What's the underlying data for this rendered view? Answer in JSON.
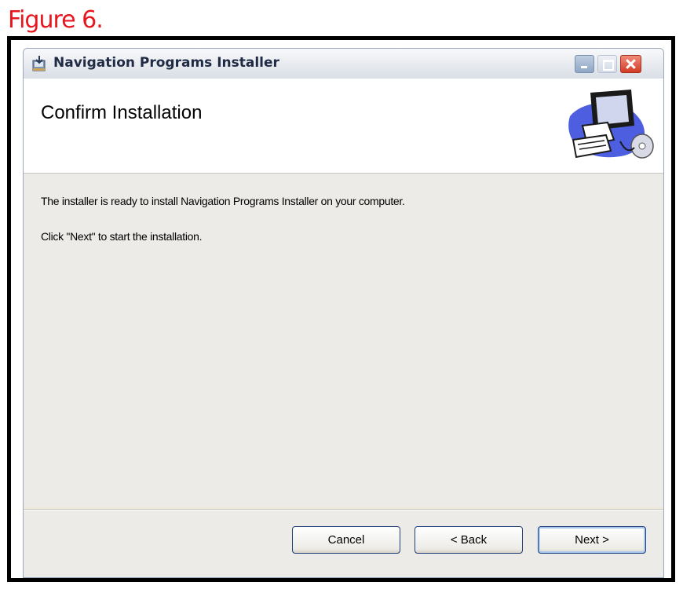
{
  "figure_label": "Figure 6.",
  "window": {
    "title": "Navigation Programs Installer",
    "controls": {
      "minimize": "minimize-icon",
      "maximize": "maximize-icon",
      "close": "close-icon"
    }
  },
  "banner": {
    "heading": "Confirm Installation",
    "art_icon": "computer-cd-icon"
  },
  "body": {
    "line1": "The installer is ready to install Navigation Programs Installer on your computer.",
    "line2": "Click \"Next\" to start the installation."
  },
  "buttons": {
    "cancel": "Cancel",
    "back": "< Back",
    "next": "Next >"
  },
  "colors": {
    "figure_label": "#e8161e",
    "window_bg": "#ecebe8",
    "close_button": "#d33c25"
  }
}
